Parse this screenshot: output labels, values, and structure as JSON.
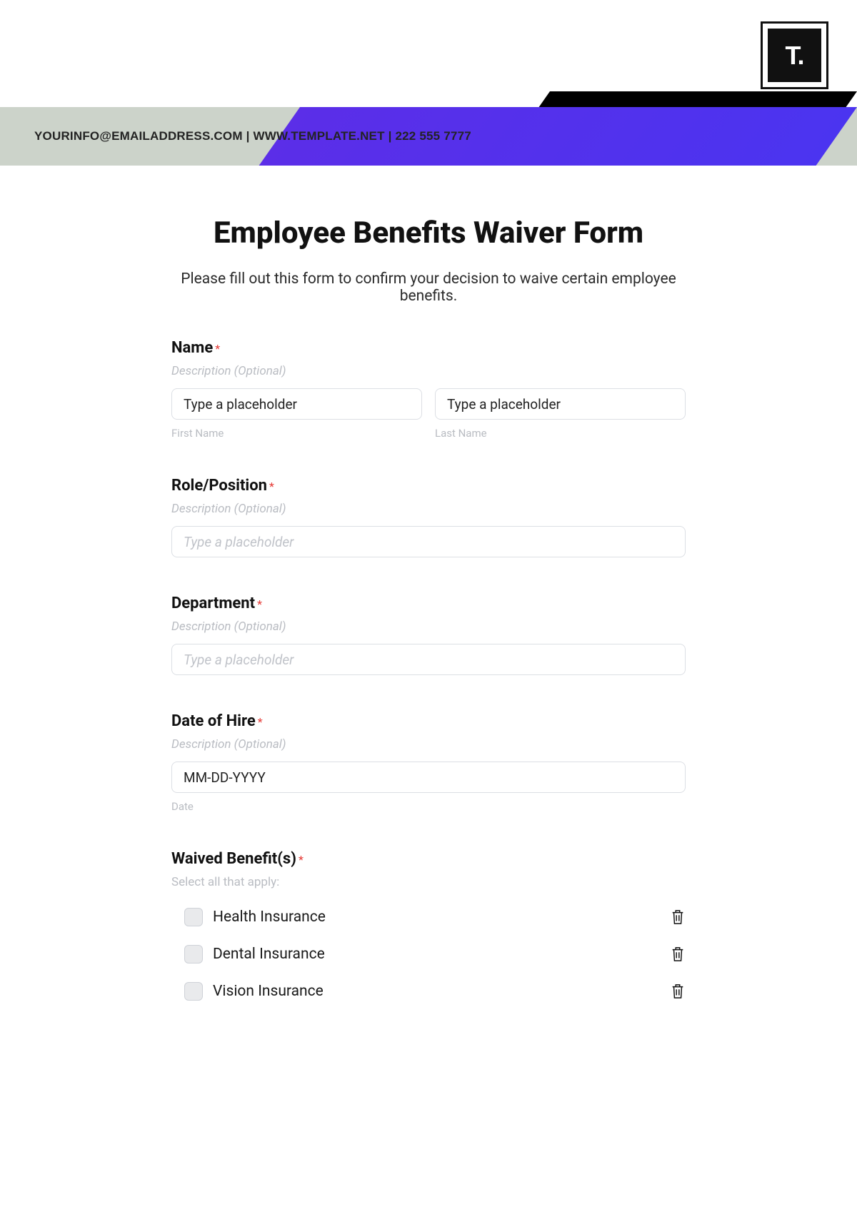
{
  "header": {
    "logo_text": "T.",
    "banner_text": "YOURINFO@EMAILADDRESS.COM | WWW.TEMPLATE.NET | 222 555 7777"
  },
  "form": {
    "title": "Employee Benefits Waiver Form",
    "subtitle": "Please fill out this form to confirm your decision to waive certain employee benefits.",
    "fields": {
      "name": {
        "label": "Name",
        "required": "*",
        "description": "Description (Optional)",
        "first_placeholder": "Type a placeholder",
        "last_placeholder": "Type a placeholder",
        "first_sublabel": "First Name",
        "last_sublabel": "Last Name"
      },
      "role": {
        "label": "Role/Position",
        "required": "*",
        "description": "Description (Optional)",
        "placeholder": "Type a placeholder"
      },
      "department": {
        "label": "Department",
        "required": "*",
        "description": "Description (Optional)",
        "placeholder": "Type a placeholder"
      },
      "hire": {
        "label": "Date of Hire",
        "required": "*",
        "description": "Description (Optional)",
        "placeholder": "MM-DD-YYYY",
        "sublabel": "Date"
      },
      "waived": {
        "label": "Waived Benefit(s)",
        "required": "*",
        "helper": "Select all that apply:",
        "options": [
          "Health Insurance",
          "Dental Insurance",
          "Vision Insurance"
        ]
      }
    }
  }
}
